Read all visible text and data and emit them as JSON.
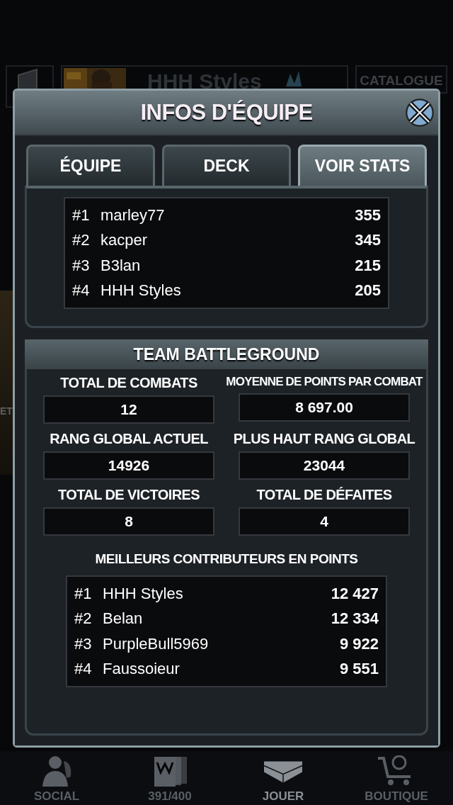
{
  "background": {
    "profile_name": "HHH Styles",
    "catalogue": "CATALOGUE",
    "side_fragment": "ET",
    "nav": [
      {
        "kind": "social",
        "label": "SOCIAL",
        "selected": false
      },
      {
        "kind": "cards",
        "label": "391/400",
        "selected": false
      },
      {
        "kind": "ring",
        "label": "JOUER",
        "selected": true
      },
      {
        "kind": "shop",
        "label": "BOUTIQUE",
        "selected": false
      }
    ]
  },
  "modal": {
    "title": "INFOS D'ÉQUIPE",
    "tabs": [
      {
        "label": "ÉQUIPE",
        "selected": false
      },
      {
        "label": "DECK",
        "selected": false
      },
      {
        "label": "VOIR STATS",
        "selected": true
      }
    ],
    "members": [
      {
        "rank": "#1",
        "name": "marley77",
        "value": "355"
      },
      {
        "rank": "#2",
        "name": "kacper",
        "value": "345"
      },
      {
        "rank": "#3",
        "name": "B3lan",
        "value": "215"
      },
      {
        "rank": "#4",
        "name": "HHH Styles",
        "value": "205"
      }
    ],
    "section_title": "TEAM BATTLEGROUND",
    "stats": [
      {
        "label": "TOTAL DE COMBATS",
        "value": "12"
      },
      {
        "label": "MOYENNE DE POINTS PAR COMBAT",
        "value": "8 697.00"
      },
      {
        "label": "RANG GLOBAL ACTUEL",
        "value": "14926"
      },
      {
        "label": "PLUS HAUT RANG GLOBAL",
        "value": "23044"
      },
      {
        "label": "TOTAL DE VICTOIRES",
        "value": "8"
      },
      {
        "label": "TOTAL DE DÉFAITES",
        "value": "4"
      }
    ],
    "contributors_title": "MEILLEURS CONTRIBUTEURS EN POINTS",
    "contributors": [
      {
        "rank": "#1",
        "name": "HHH Styles",
        "value": "12 427"
      },
      {
        "rank": "#2",
        "name": "Belan",
        "value": "12 334"
      },
      {
        "rank": "#3",
        "name": "PurpleBull5969",
        "value": "9 922"
      },
      {
        "rank": "#4",
        "name": "Faussoieur",
        "value": "9 551"
      }
    ]
  }
}
